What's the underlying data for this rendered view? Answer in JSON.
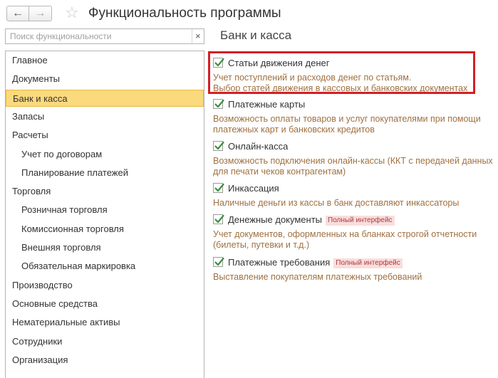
{
  "header": {
    "back_icon": "←",
    "forward_icon": "→",
    "star_icon": "☆",
    "title": "Функциональность программы"
  },
  "search": {
    "placeholder": "Поиск функциональности",
    "value": "",
    "clear_icon": "×"
  },
  "sidebar": {
    "items": [
      {
        "label": "Главное"
      },
      {
        "label": "Документы"
      },
      {
        "label": "Банк и касса"
      },
      {
        "label": "Запасы"
      },
      {
        "label": "Расчеты"
      },
      {
        "label": "Учет по договорам"
      },
      {
        "label": "Планирование платежей"
      },
      {
        "label": "Торговля"
      },
      {
        "label": "Розничная торговля"
      },
      {
        "label": "Комиссионная торговля"
      },
      {
        "label": "Внешняя торговля"
      },
      {
        "label": "Обязательная маркировка"
      },
      {
        "label": "Производство"
      },
      {
        "label": "Основные средства"
      },
      {
        "label": "Нематериальные активы"
      },
      {
        "label": "Сотрудники"
      },
      {
        "label": "Организация"
      }
    ]
  },
  "main": {
    "section_title": "Банк и касса",
    "options": [
      {
        "label": "Статьи движения денег",
        "checked": true,
        "desc": [
          "Учет поступлений и расходов денег по статьям.",
          "Выбор статей движения в кассовых и банковских документах"
        ]
      },
      {
        "label": "Платежные карты",
        "checked": true,
        "desc": [
          "Возможность оплаты товаров и услуг покупателями при помощи",
          "платежных карт и банковских кредитов"
        ]
      },
      {
        "label": "Онлайн-касса",
        "checked": true,
        "desc": [
          "Возможность подключения онлайн-кассы (ККТ с передачей данных",
          "для печати чеков контрагентам)"
        ]
      },
      {
        "label": "Инкассация",
        "checked": true,
        "desc": [
          "Наличные деньги из кассы в банк доставляют инкассаторы"
        ]
      },
      {
        "label": "Денежные документы",
        "checked": true,
        "badge": "Полный интерфейс",
        "desc": [
          "Учет документов, оформленных на бланках строгой отчетности",
          "(билеты, путевки и т.д.)"
        ]
      },
      {
        "label": "Платежные требования",
        "checked": true,
        "badge": "Полный интерфейс",
        "desc": [
          "Выставление покупателям платежных требований"
        ]
      }
    ]
  },
  "colors": {
    "active_item_bg": "#fbd97d",
    "description_text": "#a07040",
    "checkmark": "#3a8f3a",
    "highlight_frame": "#d41f26",
    "badge_bg": "#f8dede",
    "badge_text": "#b33636"
  }
}
